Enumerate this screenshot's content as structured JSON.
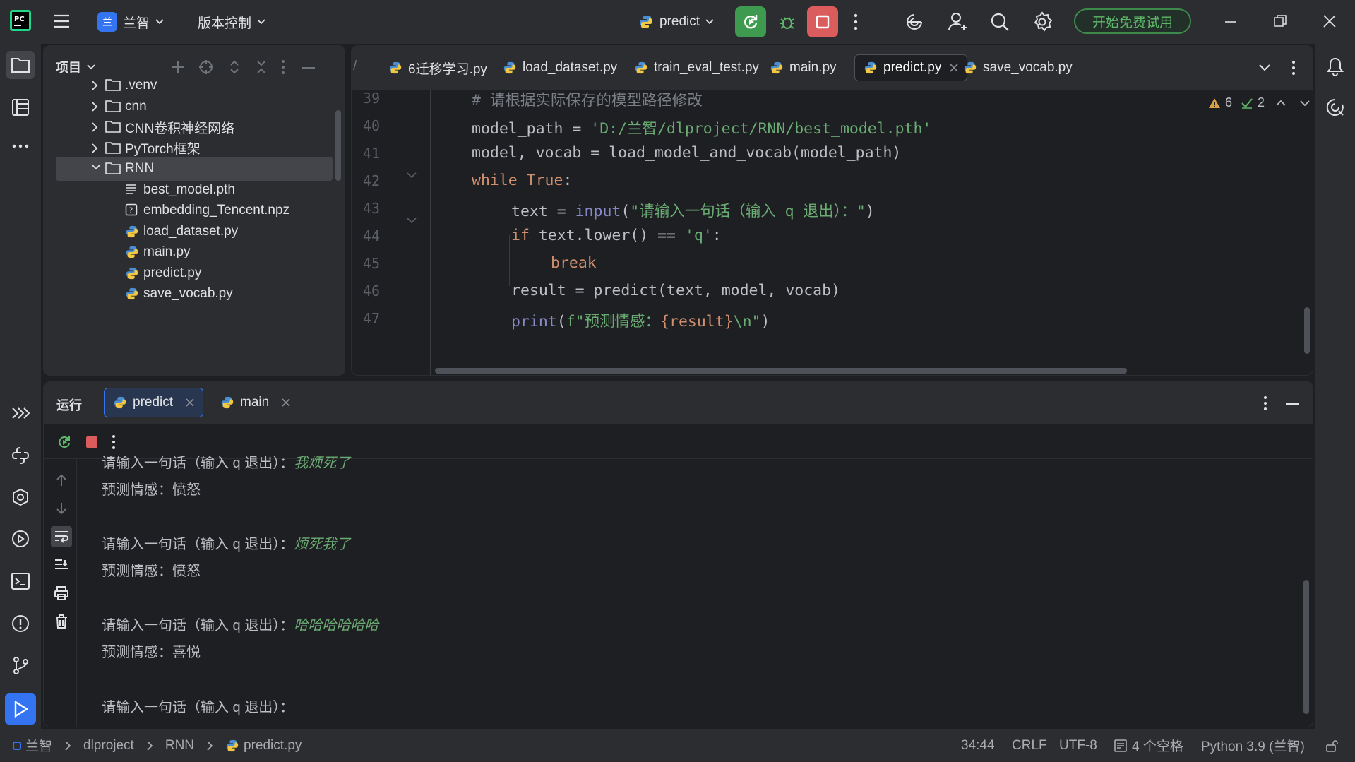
{
  "titlebar": {
    "project_name": "兰智",
    "vcs_label": "版本控制",
    "run_config": "predict",
    "trial_button": "开始免费试用"
  },
  "project_panel": {
    "title": "项目",
    "items": [
      {
        "label": ".venv",
        "type": "folder"
      },
      {
        "label": "cnn",
        "type": "folder"
      },
      {
        "label": "CNN卷积神经网络",
        "type": "folder"
      },
      {
        "label": "PyTorch框架",
        "type": "folder"
      },
      {
        "label": "RNN",
        "type": "folder-open"
      },
      {
        "label": "best_model.pth",
        "type": "file-text"
      },
      {
        "label": "embedding_Tencent.npz",
        "type": "file-unknown"
      },
      {
        "label": "load_dataset.py",
        "type": "python"
      },
      {
        "label": "main.py",
        "type": "python"
      },
      {
        "label": "predict.py",
        "type": "python"
      },
      {
        "label": "save_vocab.py",
        "type": "python"
      }
    ]
  },
  "editor": {
    "tabs": [
      {
        "label": "6迁移学习.py"
      },
      {
        "label": "load_dataset.py"
      },
      {
        "label": "train_eval_test.py"
      },
      {
        "label": "main.py"
      },
      {
        "label": "predict.py",
        "active": true
      },
      {
        "label": "save_vocab.py"
      }
    ],
    "tab_overflow_prefix": "/",
    "warnings": "6",
    "checks": "2",
    "line_numbers": [
      "39",
      "40",
      "41",
      "42",
      "43",
      "44",
      "45",
      "46",
      "47"
    ],
    "lines": {
      "l39": "# 请根据实际保存的模型路径修改",
      "l40_a": "model_path = ",
      "l40_b": "'D:/兰智/dlproject/RNN/best_model.pth'",
      "l41": "model, vocab = load_model_and_vocab(model_path)",
      "l42_a": "while ",
      "l42_b": "True",
      "l42_c": ":",
      "l43_a": "text = ",
      "l43_b": "input",
      "l43_c": "(",
      "l43_d": "\"请输入一句话（输入 q 退出）：\"",
      "l43_e": ")",
      "l44_a": "if ",
      "l44_b": "text.lower() == ",
      "l44_c": "'q'",
      "l44_d": ":",
      "l45": "break",
      "l46": "result = predict(text, model, vocab)",
      "l47_a": "print",
      "l47_b": "(",
      "l47_c": "f\"预测情感：",
      "l47_d": "{result}",
      "l47_e": "\\n\"",
      "l47_f": ")"
    }
  },
  "run_panel": {
    "title": "运行",
    "tabs": [
      {
        "label": "predict",
        "active": true
      },
      {
        "label": "main"
      }
    ],
    "console": [
      {
        "prompt": "请输入一句话（输入 q 退出）：",
        "input": "我烦死了"
      },
      {
        "prompt": "预测情感：愤怒",
        "input": ""
      },
      {
        "prompt": "请输入一句话（输入 q 退出）：",
        "input": "烦死我了"
      },
      {
        "prompt": "预测情感：愤怒",
        "input": ""
      },
      {
        "prompt": "请输入一句话（输入 q 退出）：",
        "input": "哈哈哈哈哈哈"
      },
      {
        "prompt": "预测情感：喜悦",
        "input": ""
      },
      {
        "prompt": "请输入一句话（输入 q 退出）：",
        "input": ""
      }
    ]
  },
  "statusbar": {
    "breadcrumb": [
      "兰智",
      "dlproject",
      "RNN",
      "predict.py"
    ],
    "position": "34:44",
    "line_ending": "CRLF",
    "encoding": "UTF-8",
    "indent": "4 个空格",
    "interpreter": "Python 3.9 (兰智)"
  },
  "colors": {
    "accent": "#3574f0",
    "run_green": "#3d9a4e",
    "stop_red": "#db5c5c",
    "string": "#6aab73",
    "keyword": "#cf8e6d"
  }
}
